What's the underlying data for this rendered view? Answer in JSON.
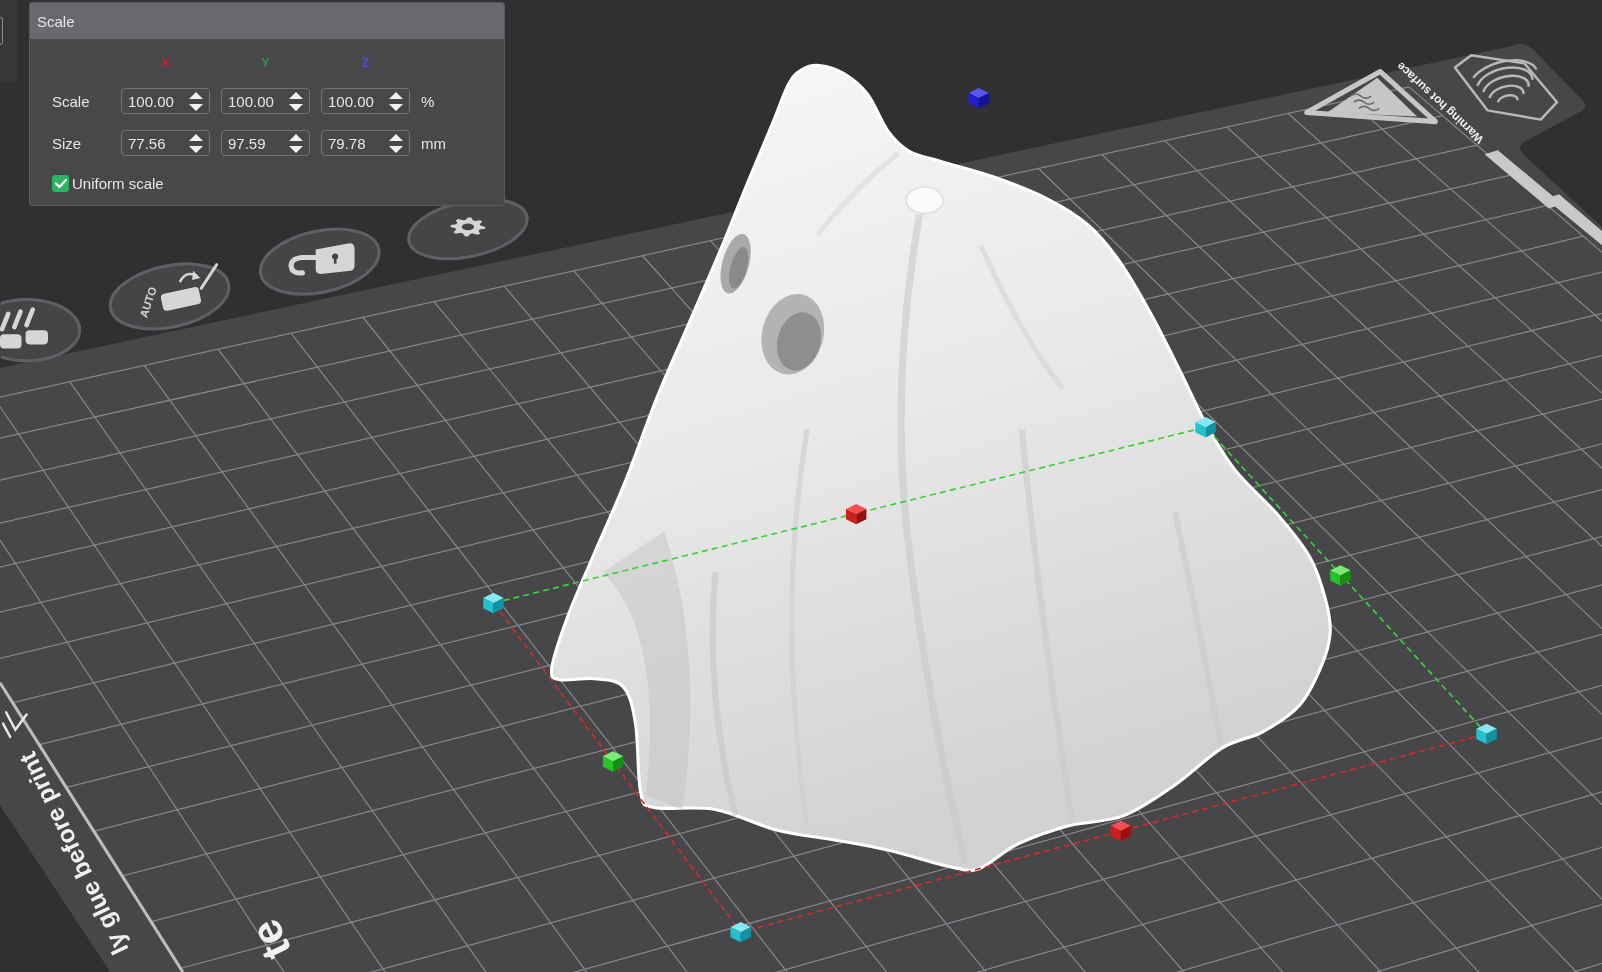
{
  "scale_panel": {
    "title": "Scale",
    "axes": [
      {
        "label": "X",
        "color": "#c0262d"
      },
      {
        "label": "Y",
        "color": "#27963f"
      },
      {
        "label": "Z",
        "color": "#4b4bf0"
      }
    ],
    "rows": [
      {
        "label": "Scale",
        "values": [
          "100.00",
          "100.00",
          "100.00"
        ],
        "unit": "%"
      },
      {
        "label": "Size",
        "values": [
          "77.56",
          "97.59",
          "79.78"
        ],
        "unit": "mm"
      }
    ],
    "uniform_scale": {
      "label": "Uniform scale",
      "checked": true
    }
  },
  "toolbar": {
    "auto_button": {
      "label": "AUTO"
    }
  },
  "plate": {
    "warning_label": "Warning hot surface",
    "edge_label": "ly glue before print",
    "front_label": "te"
  }
}
